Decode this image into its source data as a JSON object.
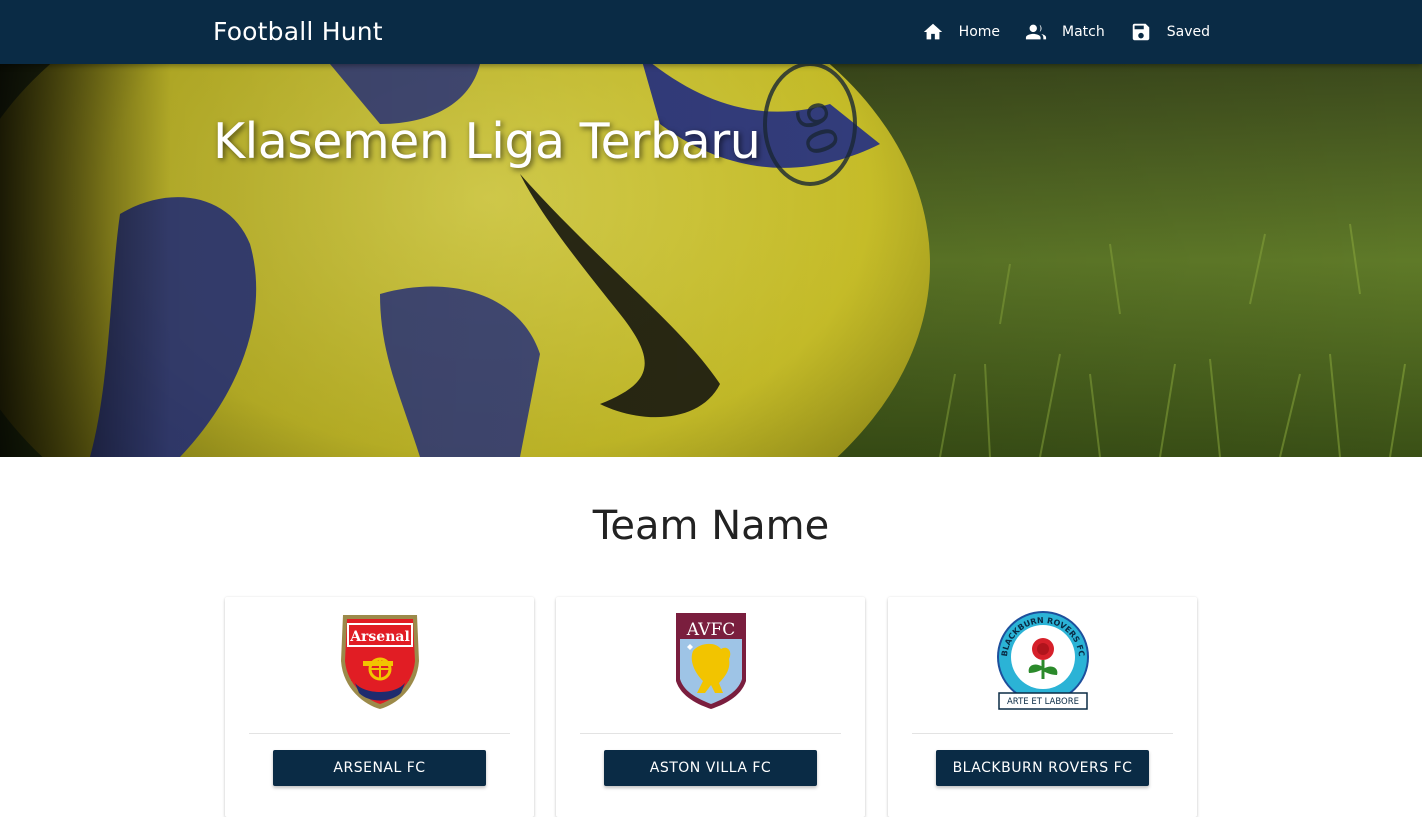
{
  "navbar": {
    "brand": "Football Hunt",
    "links": [
      {
        "label": "Home",
        "icon": "home-icon"
      },
      {
        "label": "Match",
        "icon": "people-icon"
      },
      {
        "label": "Saved",
        "icon": "save-icon"
      }
    ]
  },
  "hero": {
    "title": "Klasemen Liga Terbaru"
  },
  "section": {
    "title": "Team Name"
  },
  "teams": [
    {
      "name": "ARSENAL FC",
      "crest_text": "Arsenal",
      "crest": "arsenal-crest"
    },
    {
      "name": "ASTON VILLA FC",
      "crest_text": "AVFC",
      "crest": "aston-villa-crest"
    },
    {
      "name": "BLACKBURN ROVERS FC",
      "crest_text": "BLACKBURN ROVERS FC",
      "crest_motto": "ARTE ET LABORE",
      "crest_year_a": "18",
      "crest_year_b": "75",
      "crest": "blackburn-rovers-crest"
    }
  ],
  "colors": {
    "navbar": "#0a2b45",
    "button": "#0a2b45",
    "ball_yellow": "#e8dc3a",
    "ball_blue": "#2e3a8c",
    "grass": "#5d7a2a"
  }
}
